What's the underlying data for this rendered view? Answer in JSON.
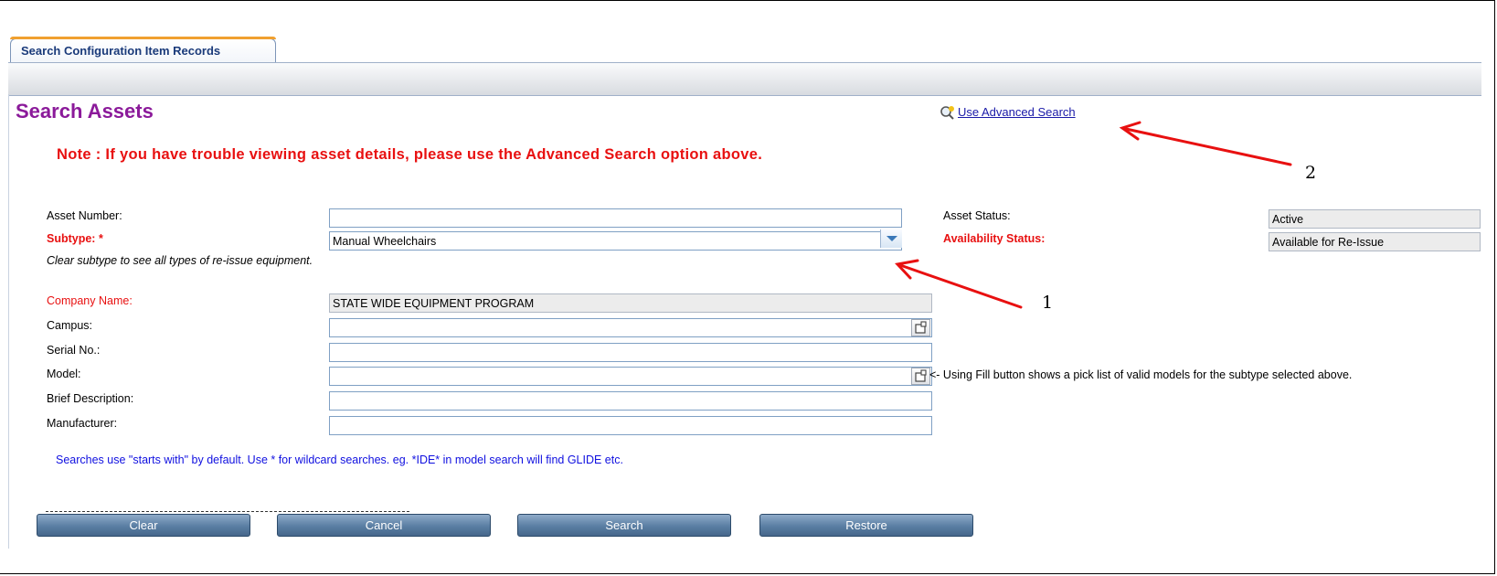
{
  "tab": {
    "label": "Search Configuration Item Records"
  },
  "page_title": "Search Assets",
  "advanced_search_link": "Use Advanced Search",
  "note": "Note : If you have trouble viewing asset details, please use the Advanced Search option above.",
  "form": {
    "asset_number": {
      "label": "Asset Number:",
      "value": ""
    },
    "subtype": {
      "label": "Subtype: *",
      "value": "Manual Wheelchairs"
    },
    "subtype_hint": "Clear subtype to see all types of re-issue equipment.",
    "asset_status": {
      "label": "Asset Status:",
      "value": "Active"
    },
    "availability_status": {
      "label": "Availability Status:",
      "value": "Available for Re-Issue"
    },
    "company_name": {
      "label": "Company Name:",
      "value": "STATE WIDE EQUIPMENT PROGRAM"
    },
    "campus": {
      "label": "Campus:",
      "value": ""
    },
    "serial_no": {
      "label": "Serial No.:",
      "value": ""
    },
    "model": {
      "label": "Model:",
      "value": ""
    },
    "model_note": "<- Using Fill button shows a pick list of valid models for the subtype selected above.",
    "brief_description": {
      "label": "Brief Description:",
      "value": ""
    },
    "manufacturer": {
      "label": "Manufacturer:",
      "value": ""
    }
  },
  "search_note": "Searches use \"starts with\" by default. Use * for wildcard searches. eg. *IDE* in model search will find GLIDE etc.",
  "buttons": {
    "clear": "Clear",
    "cancel": "Cancel",
    "search": "Search",
    "restore": "Restore"
  },
  "annotations": {
    "arrow1": "1",
    "arrow2": "2"
  },
  "colors": {
    "title": "#8b1a9a",
    "note": "#e81010",
    "link": "#1a1aa8",
    "button": "#5a7ea3"
  },
  "icons": [
    "magnifier-icon",
    "dropdown-arrow-icon",
    "fill-button-icon"
  ]
}
